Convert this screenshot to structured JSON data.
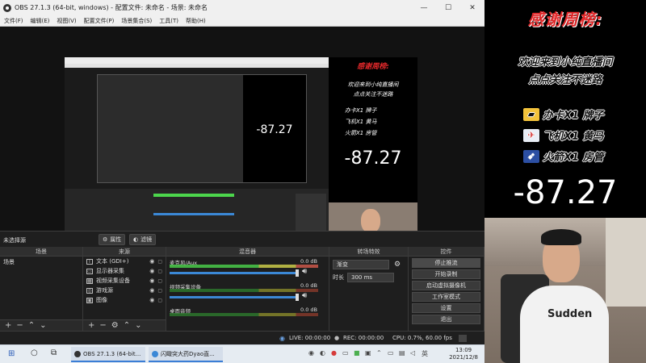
{
  "window": {
    "title": "OBS 27.1.3 (64-bit, windows) - 配置文件: 未命名 - 场景: 未命名",
    "minimize": "—",
    "maximize": "☐",
    "close": "✕"
  },
  "menu": [
    "文件(F)",
    "编辑(E)",
    "视图(V)",
    "配置文件(P)",
    "场景集合(S)",
    "工具(T)",
    "帮助(H)"
  ],
  "nested": {
    "promo_title": "感谢周榜:",
    "welcome_1": "欢迎来到小纯直播间",
    "welcome_2": "点点关注不迷路",
    "rank_1": "办卡X1 牌子",
    "rank_2": "飞机X1 黄马",
    "rank_3": "火箭X1 房管",
    "number": "-87.27",
    "nested_number": "-87.27"
  },
  "dockbar": {
    "no_source": "未选择源",
    "props_btn": "属性",
    "filters_btn": "滤镜"
  },
  "docks": {
    "scenes": {
      "title": "场景",
      "items": [
        "场景"
      ]
    },
    "sources": {
      "title": "来源",
      "items": [
        {
          "icon": "T",
          "label": "文本 (GDI+)"
        },
        {
          "icon": "▭",
          "label": "显示器采集"
        },
        {
          "icon": "▦",
          "label": "视频采集设备"
        },
        {
          "icon": "◎",
          "label": "游戏源"
        },
        {
          "icon": "▣",
          "label": "图像"
        }
      ]
    },
    "mixer": {
      "title": "混音器",
      "channels": [
        {
          "name": "麦克风/Aux",
          "db": "0.0 dB",
          "active": true
        },
        {
          "name": "视频采集设备",
          "db": "0.0 dB",
          "active": false
        },
        {
          "name": "桌面音频",
          "db": "0.0 dB",
          "active": false
        }
      ]
    },
    "transitions": {
      "title": "转场特效",
      "type": "渐变",
      "duration_label": "时长",
      "duration_value": "300 ms"
    },
    "controls": {
      "title": "控件",
      "buttons": [
        "停止推流",
        "开始录制",
        "启动虚拟摄像机",
        "工作室模式",
        "设置",
        "退出"
      ]
    }
  },
  "status": {
    "live": "LIVE: 00:00:00",
    "rec": "REC: 00:00:00",
    "cpu": "CPU: 0.7%, 60.00 fps"
  },
  "taskbar": {
    "app1": "OBS 27.1.3 (64-bit...",
    "app2": "闪瞰突大药Dyao直...",
    "time": "13:09",
    "date": "2021/12/8"
  },
  "overlay": {
    "title": "感谢周榜:",
    "welcome_1": "欢迎来到小纯直播间",
    "welcome_2": "点点关注不迷路",
    "rank_1": "办卡X1 牌子",
    "rank_2": "飞机X1 黄马",
    "rank_3": "火箭X1 房管",
    "number": "-87.27",
    "shirt_logo": "Sudden"
  },
  "colors": {
    "accent_red": "#e0282a",
    "meter_green": "#4cd64c",
    "fader_blue": "#3b88d6",
    "taskbar_bg": "#e6ecf2"
  },
  "icons": {
    "card": "credit-card-icon",
    "plane": "plane-icon",
    "rocket": "rocket-icon"
  }
}
